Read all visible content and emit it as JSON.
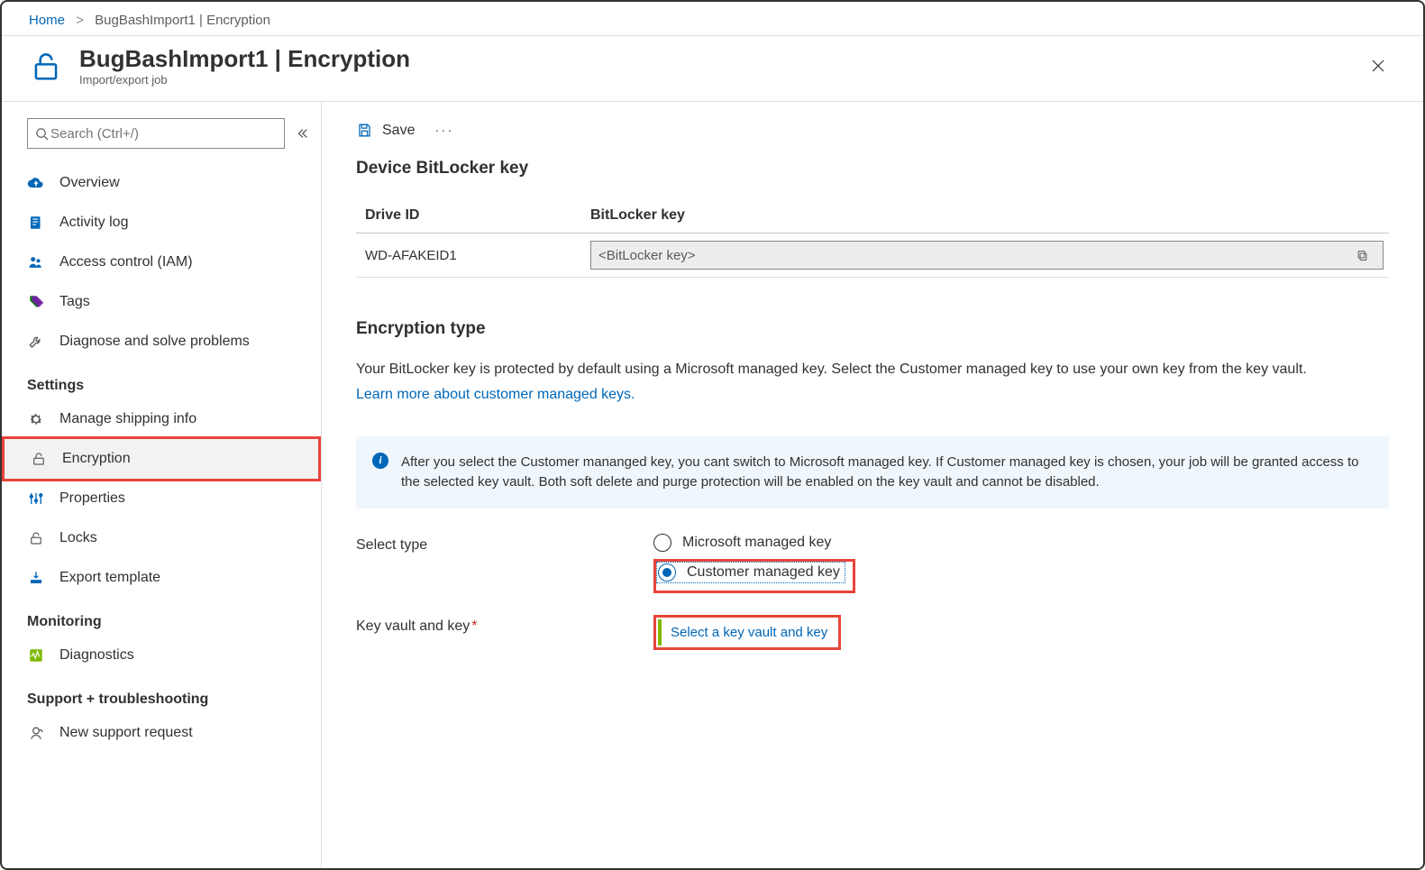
{
  "breadcrumb": {
    "home": "Home",
    "current": "BugBashImport1 | Encryption"
  },
  "heading": {
    "title": "BugBashImport1 | Encryption",
    "subtitle": "Import/export job"
  },
  "search": {
    "placeholder": "Search (Ctrl+/)"
  },
  "sidebar": {
    "items": [
      {
        "label": "Overview",
        "icon": "cloud"
      },
      {
        "label": "Activity log",
        "icon": "log"
      },
      {
        "label": "Access control (IAM)",
        "icon": "people"
      },
      {
        "label": "Tags",
        "icon": "tags"
      },
      {
        "label": "Diagnose and solve problems",
        "icon": "wrench"
      }
    ],
    "groups": [
      {
        "heading": "Settings",
        "items": [
          {
            "label": "Manage shipping info",
            "icon": "gear"
          },
          {
            "label": "Encryption",
            "icon": "lock",
            "selected": true,
            "highlight": true
          },
          {
            "label": "Properties",
            "icon": "sliders"
          },
          {
            "label": "Locks",
            "icon": "lock"
          },
          {
            "label": "Export template",
            "icon": "export"
          }
        ]
      },
      {
        "heading": "Monitoring",
        "items": [
          {
            "label": "Diagnostics",
            "icon": "diag"
          }
        ]
      },
      {
        "heading": "Support + troubleshooting",
        "items": [
          {
            "label": "New support request",
            "icon": "support"
          }
        ]
      }
    ]
  },
  "toolbar": {
    "save": "Save"
  },
  "bitlocker": {
    "heading": "Device BitLocker key",
    "col_drive": "Drive ID",
    "col_key": "BitLocker key",
    "rows": [
      {
        "drive": "WD-AFAKEID1",
        "key": "<BitLocker key>"
      }
    ]
  },
  "encryption": {
    "heading": "Encryption type",
    "desc": "Your BitLocker key is protected by default using a Microsoft managed key. Select the Customer managed key to use your own key from the key vault.",
    "learn": "Learn more about customer managed keys.",
    "info": "After you select the Customer mananged key, you cant switch to Microsoft managed key. If Customer managed key is chosen, your job will be granted access to the selected key vault. Both soft delete and purge protection will be enabled on the key vault and cannot be disabled.",
    "select_type": "Select type",
    "opt_ms": "Microsoft managed key",
    "opt_cust": "Customer managed key",
    "kv_label": "Key vault and key",
    "kv_link": "Select a key vault and key"
  }
}
